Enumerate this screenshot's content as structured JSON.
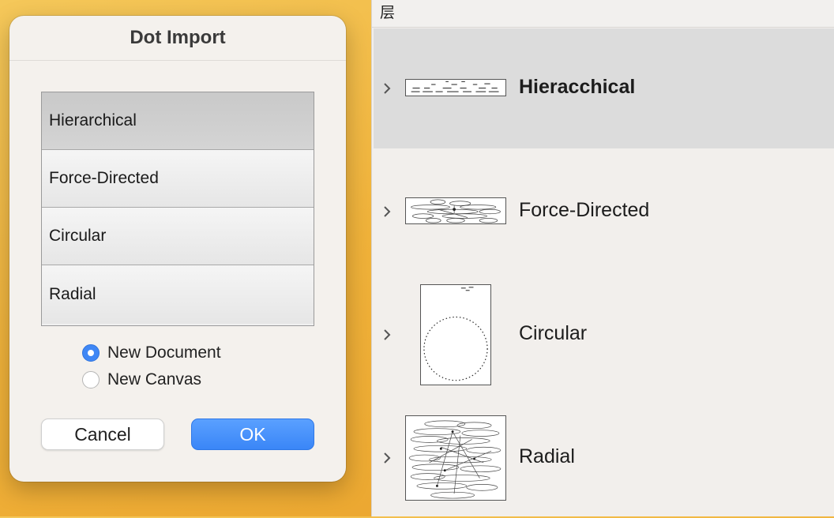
{
  "dialog": {
    "title": "Dot Import",
    "layouts": [
      "Hierarchical",
      "Force-Directed",
      "Circular",
      "Radial"
    ],
    "selected_layout": "Hierarchical",
    "target_options": [
      "New Document",
      "New Canvas"
    ],
    "selected_target": "New Document",
    "cancel_label": "Cancel",
    "ok_label": "OK"
  },
  "layers_panel": {
    "header": "层",
    "layers": [
      {
        "name": "Hieracchical",
        "selected": true
      },
      {
        "name": "Force-Directed",
        "selected": false
      },
      {
        "name": "Circular",
        "selected": false
      },
      {
        "name": "Radial",
        "selected": false
      }
    ]
  },
  "colors": {
    "accent": "#3a86f7",
    "selected_row": "#dcdcdc",
    "panel_bg": "#f2efec",
    "desktop": "#f0b23a"
  }
}
